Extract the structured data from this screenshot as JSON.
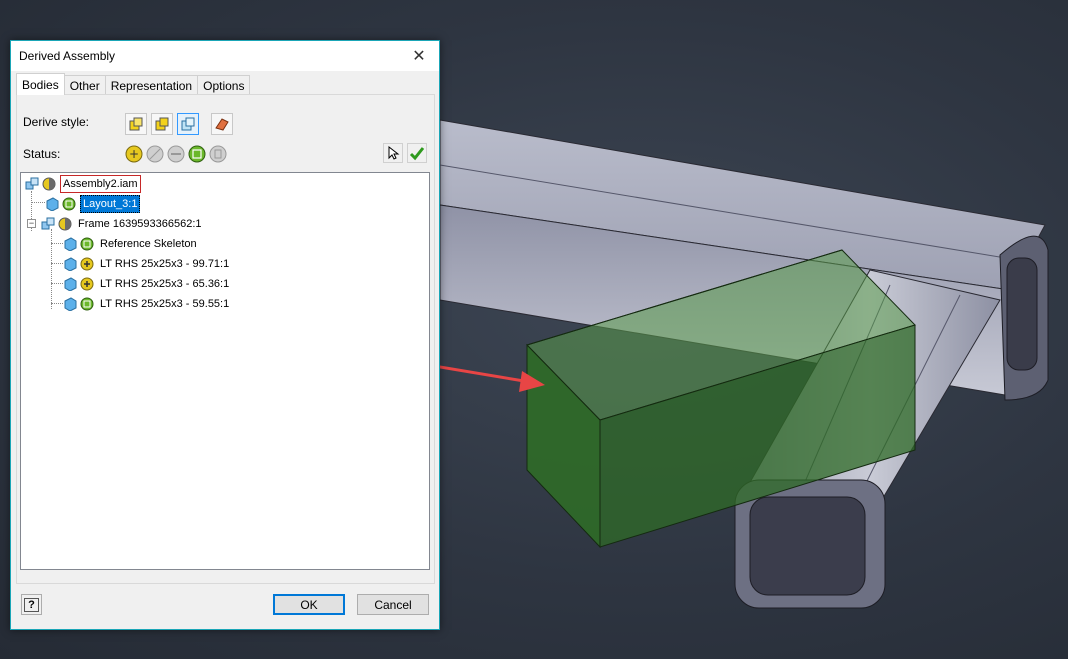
{
  "dialog": {
    "title": "Derived Assembly",
    "close_glyph": "✕",
    "tabs": [
      "Bodies",
      "Other",
      "Representation",
      "Options"
    ],
    "derive_style_label": "Derive style:",
    "status_label": "Status:",
    "help_glyph": "?",
    "ok_label": "OK",
    "cancel_label": "Cancel"
  },
  "tree": {
    "root": "Assembly2.iam",
    "layout": "Layout_3:1",
    "frame": "Frame 1639593366562:1",
    "children": [
      "Reference Skeleton",
      "LT RHS 25x25x3 - 99.71:1",
      "LT RHS 25x25x3 - 65.36:1",
      "LT RHS 25x25x3 - 59.55:1"
    ]
  },
  "colors": {
    "accent": "#1aa6b7",
    "selection": "#0078d7",
    "status_include": "#6bb82b",
    "status_mixed": "#e6c81f",
    "arrow": "#e84545",
    "preview_green": "#2f6b27"
  },
  "icons": [
    "close-icon",
    "help-icon",
    "select-icon",
    "check-icon",
    "part-cube-icon",
    "assembly-icon"
  ]
}
